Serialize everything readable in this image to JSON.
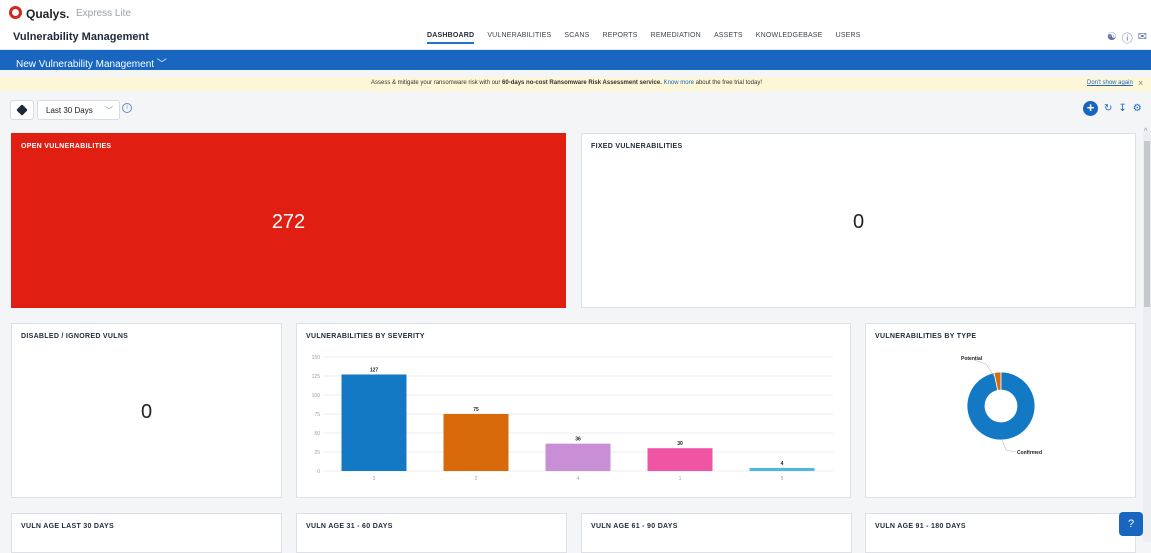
{
  "app": {
    "brand": "Qualys.",
    "edition": "Express Lite",
    "module": "Vulnerability Management"
  },
  "nav": [
    "DASHBOARD",
    "VULNERABILITIES",
    "SCANS",
    "REPORTS",
    "REMEDIATION",
    "ASSETS",
    "KNOWLEDGEBASE",
    "USERS"
  ],
  "subbar": {
    "title": "New Vulnerability Management"
  },
  "banner": {
    "prefix": "Assess & mitigate your ransomware risk with our ",
    "bold": "60-days no-cost Ransomware Risk Assessment service.",
    "link": "Know more",
    "suffix": " about the free trial today!",
    "dismiss": "Don't show again"
  },
  "filter": {
    "range": "Last 30 Days"
  },
  "widgets": {
    "open": {
      "title": "OPEN VULNERABILITIES",
      "value": "272",
      "color": "#e01f12"
    },
    "fixed": {
      "title": "FIXED VULNERABILITIES",
      "value": "0"
    },
    "disabled": {
      "title": "DISABLED / IGNORED VULNS",
      "value": "0"
    },
    "severity": {
      "title": "VULNERABILITIES BY SEVERITY"
    },
    "type": {
      "title": "VULNERABILITIES BY TYPE"
    },
    "age30": {
      "title": "VULN AGE LAST 30 DAYS"
    },
    "age60": {
      "title": "VULN AGE 31 - 60 DAYS"
    },
    "age90": {
      "title": "VULN AGE 61 - 90 DAYS"
    },
    "age180": {
      "title": "VULN AGE 91 - 180 DAYS"
    }
  },
  "chart_data": [
    {
      "type": "bar",
      "title": "VULNERABILITIES BY SEVERITY",
      "categories": [
        "3",
        "2",
        "4",
        "1",
        "5"
      ],
      "values": [
        127,
        75,
        36,
        30,
        4
      ],
      "colors": [
        "#1479c4",
        "#d96a0b",
        "#c98fd6",
        "#f055a3",
        "#4fb7e3"
      ],
      "yticks": [
        0,
        25,
        50,
        75,
        100,
        125,
        150
      ],
      "ylim": [
        0,
        150
      ]
    },
    {
      "type": "pie",
      "title": "VULNERABILITIES BY TYPE",
      "labels": [
        "Potential",
        "Confirmed"
      ],
      "values": [
        9,
        263
      ],
      "colors": [
        "#d96a0b",
        "#1479c4"
      ]
    }
  ]
}
